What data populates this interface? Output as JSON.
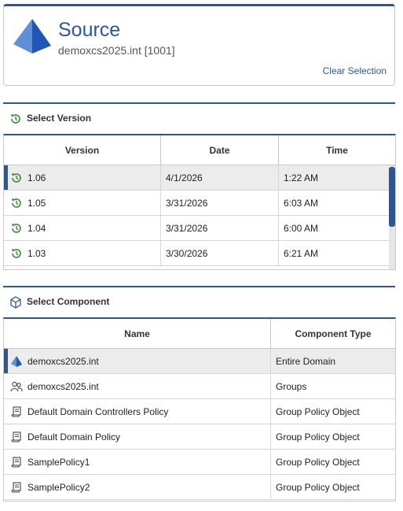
{
  "source": {
    "title": "Source",
    "subtitle": "demoxcs2025.int [1001]",
    "clear_selection": "Clear Selection"
  },
  "version_section": {
    "title": "Select Version",
    "columns": [
      "Version",
      "Date",
      "Time"
    ],
    "rows": [
      {
        "version": "1.06",
        "date": "4/1/2026",
        "time": "1:22 AM",
        "selected": true
      },
      {
        "version": "1.05",
        "date": "3/31/2026",
        "time": "6:03 AM"
      },
      {
        "version": "1.04",
        "date": "3/31/2026",
        "time": "6:00 AM"
      },
      {
        "version": "1.03",
        "date": "3/30/2026",
        "time": "6:21 AM"
      }
    ]
  },
  "component_section": {
    "title": "Select Component",
    "columns": [
      "Name",
      "Component Type"
    ],
    "rows": [
      {
        "name": "demoxcs2025.int",
        "type": "Entire Domain",
        "icon": "domain-pyramid-icon",
        "selected": true
      },
      {
        "name": "demoxcs2025.int",
        "type": "Groups",
        "icon": "groups-icon"
      },
      {
        "name": "Default Domain Controllers Policy",
        "type": "Group Policy Object",
        "icon": "policy-scroll-icon"
      },
      {
        "name": "Default Domain Policy",
        "type": "Group Policy Object",
        "icon": "policy-scroll-icon"
      },
      {
        "name": "SamplePolicy1",
        "type": "Group Policy Object",
        "icon": "policy-scroll-icon"
      },
      {
        "name": "SamplePolicy2",
        "type": "Group Policy Object",
        "icon": "policy-scroll-icon"
      }
    ]
  },
  "colors": {
    "accent": "#2b5797",
    "history_icon": "#3a8a3a"
  }
}
